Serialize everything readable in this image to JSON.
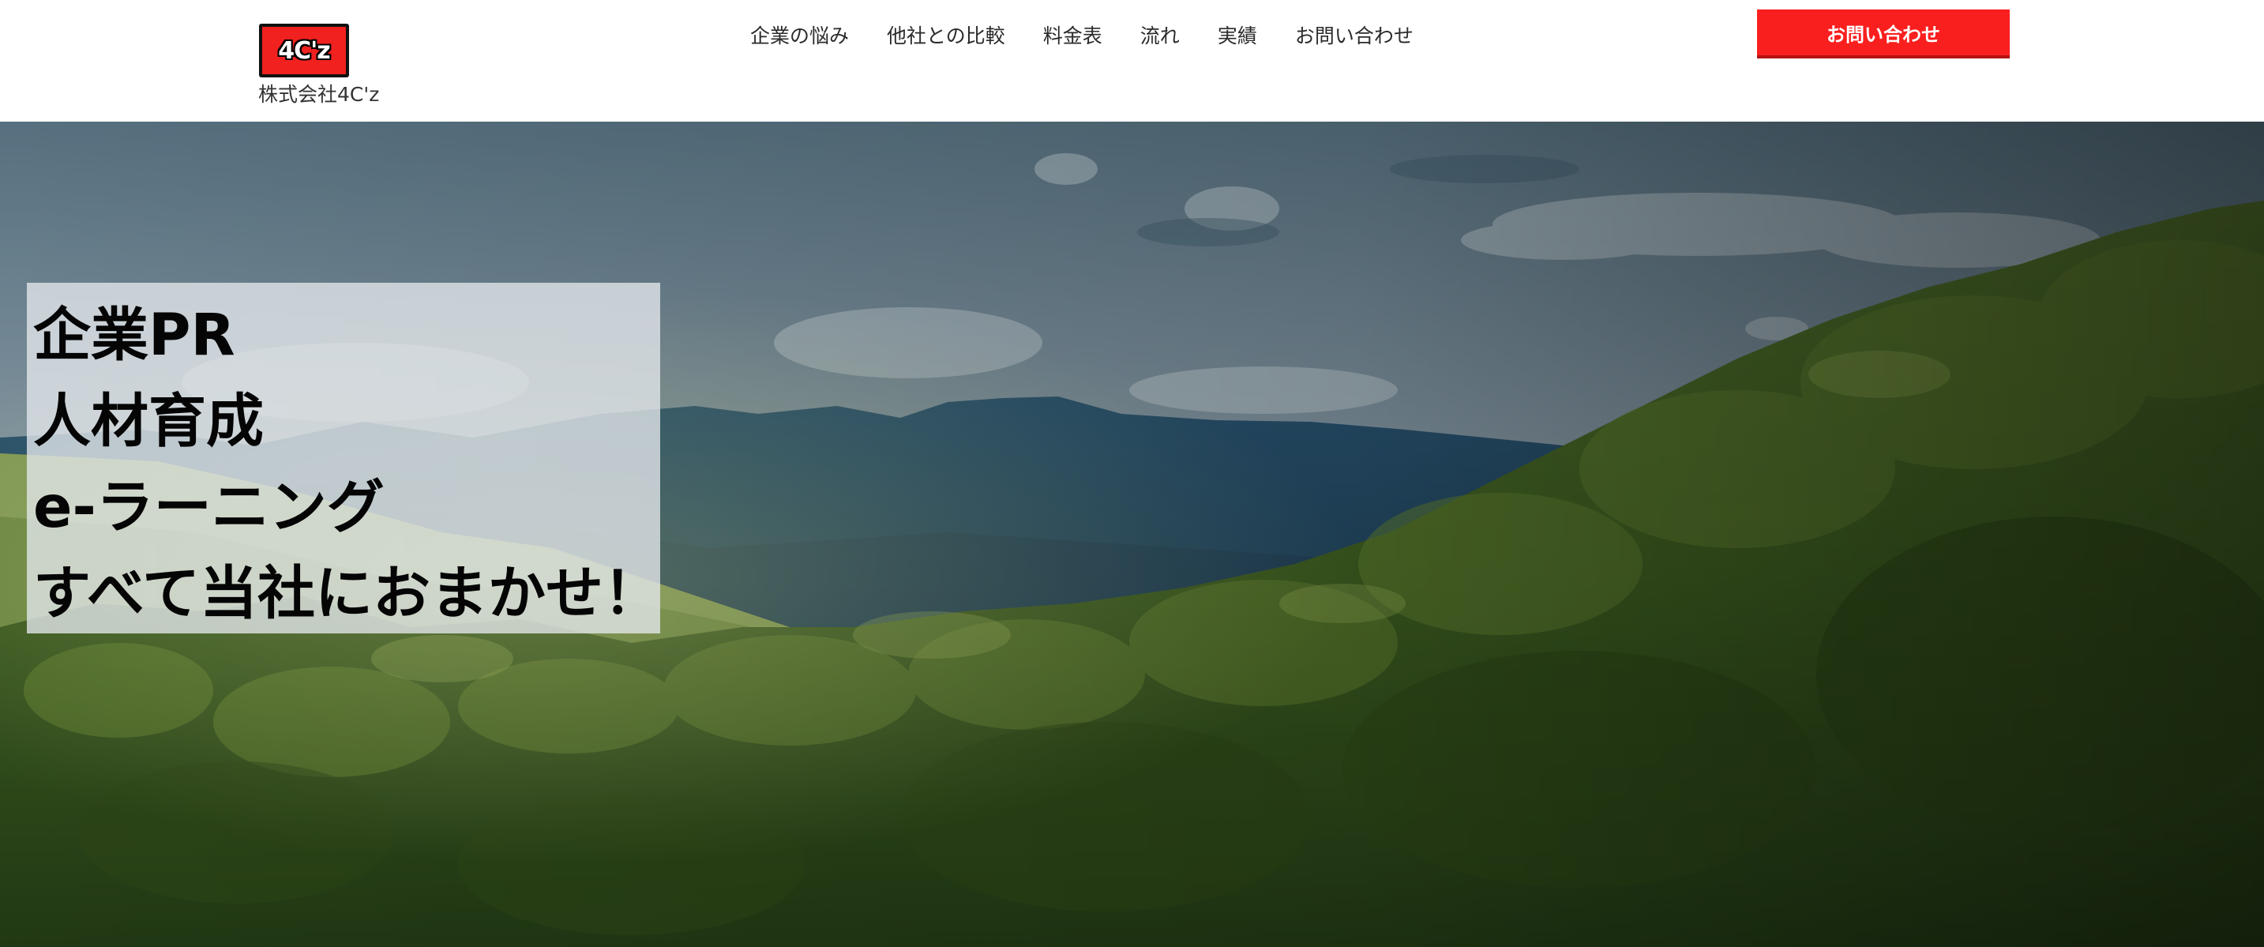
{
  "header": {
    "logo_text": "4C'z",
    "company_name": "株式会社4C'z",
    "nav": [
      {
        "label": "企業の悩み"
      },
      {
        "label": "他社との比較"
      },
      {
        "label": "料金表"
      },
      {
        "label": "流れ"
      },
      {
        "label": "実績"
      },
      {
        "label": "お問い合わせ"
      }
    ],
    "contact_button_label": "お問い合わせ"
  },
  "hero": {
    "lines": [
      "企業PR",
      "人材育成",
      "e-ラーニング",
      "すべて当社におまかせ！"
    ]
  },
  "colors": {
    "accent": "#fa1f1f",
    "text": "#2b2b2b",
    "panel_bg": "#e4e8ec"
  },
  "icons": {
    "logo": "4cz-logo-badge",
    "hero_background": "forest-mountain-landscape-photo"
  }
}
